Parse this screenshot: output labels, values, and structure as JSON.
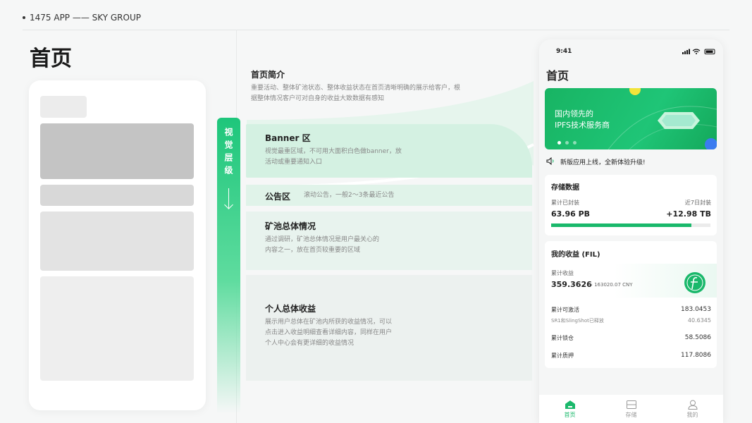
{
  "header": {
    "text": "1475 APP —— SKY GROUP"
  },
  "page_title": "首页",
  "level_bar": "视觉层级",
  "sections": {
    "intro": {
      "title": "首页简介",
      "desc1": "重要活动、整体矿池状态、整体收益状态在首页清晰明确的展示给客户，根",
      "desc2": "据整体情况客户可对自身的收益大致数据有感知"
    },
    "banner": {
      "title": "Banner 区",
      "desc1": "视觉最重区域，不可用大面积白色做banner，放",
      "desc2": "活动或重要通知入口"
    },
    "notice": {
      "title": "公告区",
      "desc": "滚动公告，一般2～3条最近公告"
    },
    "pool": {
      "title": "矿池总体情况",
      "desc1": "通过调研，矿池总体情况是用户最关心的",
      "desc2": "内容之一，放在首页较重要的区域"
    },
    "income": {
      "title": "个人总体收益",
      "desc1": "展示用户总体在矿池内所获的收益情况，可以",
      "desc2": "点击进入收益明细查看详细内容，同样在用户",
      "desc3": "个人中心会有更详细的收益情况"
    }
  },
  "phone": {
    "time": "9:41",
    "title": "首页",
    "banner_line1": "国内领先的",
    "banner_line2": "IPFS技术服务商",
    "notice": "新版应用上线，全新体验升级!",
    "storage": {
      "title": "存储数据",
      "left_label": "累计已封装",
      "right_label": "近7日封装",
      "left_value": "63.96 PB",
      "right_value": "+12.98 TB",
      "progress": 0.88
    },
    "income": {
      "title": "我的收益 (FIL)",
      "cum_label": "累计收益",
      "cum_value": "359.3626",
      "cum_cny": "≈ 163020.07 CNY",
      "rows": [
        {
          "label": "累计可激活",
          "value": "183.0453"
        },
        {
          "label": "SR1和SlingShot已释放",
          "value": "40.6345"
        },
        {
          "label": "累计锁仓",
          "value": "58.5086"
        },
        {
          "label": "累计质押",
          "value": "117.8086"
        }
      ]
    },
    "tabs": [
      {
        "label": "首页"
      },
      {
        "label": "存储"
      },
      {
        "label": "我的"
      }
    ]
  },
  "colors": {
    "accent": "#1ab86b"
  }
}
